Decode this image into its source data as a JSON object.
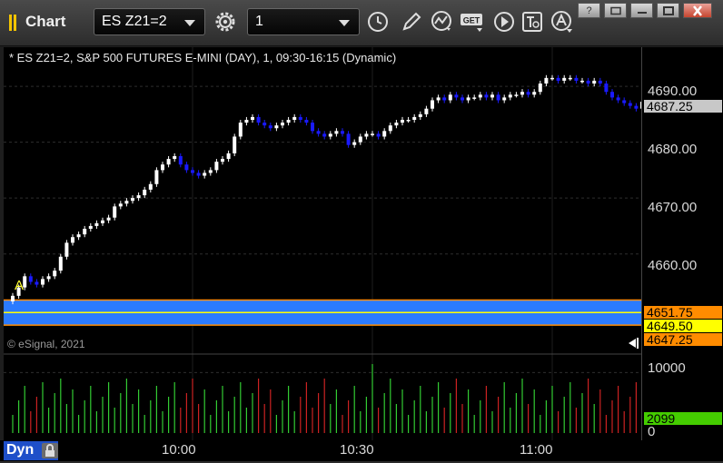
{
  "window": {
    "title": "Chart",
    "symbol_value": "ES Z21=2",
    "interval_value": "1"
  },
  "chart": {
    "description": "* ES Z21=2, S&P 500 FUTURES E-MINI (DAY), 1, 09:30-16:15 (Dynamic)",
    "marker_label": "A",
    "copyright": "© eSignal, 2021",
    "price_ticks": [
      "4690.00",
      "4680.00",
      "4670.00",
      "4660.00"
    ],
    "current_price": "4687.25",
    "levels": [
      {
        "label": "4651.75",
        "color": "#ff8c00"
      },
      {
        "label": "4649.50",
        "color": "#ffff00"
      },
      {
        "label": "4647.25",
        "color": "#ff8c00"
      }
    ],
    "volume_ticks": [
      "10000",
      "0"
    ],
    "current_volume": "2099",
    "time_labels": [
      "10:00",
      "10:30",
      "11:00"
    ],
    "mode_label": "Dyn"
  },
  "colors": {
    "up_candle": "#ffffff",
    "down_candle": "#1a1aff",
    "volume_up": "#33cc33",
    "volume_down": "#cc2222",
    "level_band": "#2b7bff"
  },
  "chart_data": {
    "type": "candlestick",
    "x": [
      "09:30",
      "09:31",
      "09:32",
      "09:33",
      "09:34",
      "09:35",
      "09:36",
      "09:37",
      "09:38",
      "09:39",
      "09:40",
      "09:41",
      "09:42",
      "09:43",
      "09:44",
      "09:45",
      "09:46",
      "09:47",
      "09:48",
      "09:49",
      "09:50",
      "09:51",
      "09:52",
      "09:53",
      "09:54",
      "09:55",
      "09:56",
      "09:57",
      "09:58",
      "09:59",
      "10:00",
      "10:01",
      "10:02",
      "10:03",
      "10:04",
      "10:05",
      "10:06",
      "10:07",
      "10:08",
      "10:09",
      "10:10",
      "10:11",
      "10:12",
      "10:13",
      "10:14",
      "10:15",
      "10:16",
      "10:17",
      "10:18",
      "10:19",
      "10:20",
      "10:21",
      "10:22",
      "10:23",
      "10:24",
      "10:25",
      "10:26",
      "10:27",
      "10:28",
      "10:29",
      "10:30",
      "10:31",
      "10:32",
      "10:33",
      "10:34",
      "10:35",
      "10:36",
      "10:37",
      "10:38",
      "10:39",
      "10:40",
      "10:41",
      "10:42",
      "10:43",
      "10:44",
      "10:45",
      "10:46",
      "10:47",
      "10:48",
      "10:49",
      "10:50",
      "10:51",
      "10:52",
      "10:53",
      "10:54",
      "10:55",
      "10:56",
      "10:57",
      "10:58",
      "10:59",
      "11:00",
      "11:01",
      "11:02",
      "11:03",
      "11:04",
      "11:05",
      "11:06",
      "11:07",
      "11:08",
      "11:09",
      "11:10",
      "11:11",
      "11:12",
      "11:13",
      "11:14",
      "11:15"
    ],
    "close": [
      4652.5,
      4654.0,
      4656.0,
      4655.0,
      4654.5,
      4655.5,
      4656.0,
      4657.0,
      4659.5,
      4662.0,
      4663.0,
      4663.5,
      4664.5,
      4665.0,
      4665.5,
      4666.0,
      4666.5,
      4668.5,
      4669.0,
      4669.5,
      4670.0,
      4670.5,
      4671.5,
      4672.5,
      4675.0,
      4676.0,
      4677.0,
      4677.5,
      4676.0,
      4675.0,
      4674.5,
      4674.0,
      4674.5,
      4675.0,
      4676.5,
      4677.0,
      4678.0,
      4681.0,
      4683.5,
      4684.0,
      4684.5,
      4683.5,
      4683.0,
      4682.5,
      4683.0,
      4683.5,
      4684.0,
      4684.5,
      4684.0,
      4683.5,
      4682.0,
      4681.5,
      4681.0,
      4681.5,
      4682.0,
      4681.5,
      4679.5,
      4680.0,
      4681.0,
      4681.5,
      4681.5,
      4681.0,
      4682.0,
      4683.0,
      4683.5,
      4684.0,
      4684.0,
      4684.5,
      4685.0,
      4686.0,
      4687.5,
      4688.0,
      4687.5,
      4688.5,
      4688.0,
      4687.5,
      4688.0,
      4688.0,
      4688.5,
      4688.0,
      4688.5,
      4687.5,
      4688.0,
      4688.5,
      4688.5,
      4689.0,
      4688.5,
      4689.0,
      4690.5,
      4691.5,
      4691.5,
      4691.0,
      4691.5,
      4691.5,
      4691.0,
      4691.0,
      4690.5,
      4691.0,
      4690.5,
      4689.0,
      4688.0,
      4687.5,
      4687.0,
      4686.5,
      4686.0,
      4687.25
    ],
    "ylim": [
      4645,
      4697
    ],
    "volume_ylim": [
      0,
      12000
    ],
    "current_volume": 2099,
    "levels": [
      4651.75,
      4649.5,
      4647.25
    ]
  }
}
